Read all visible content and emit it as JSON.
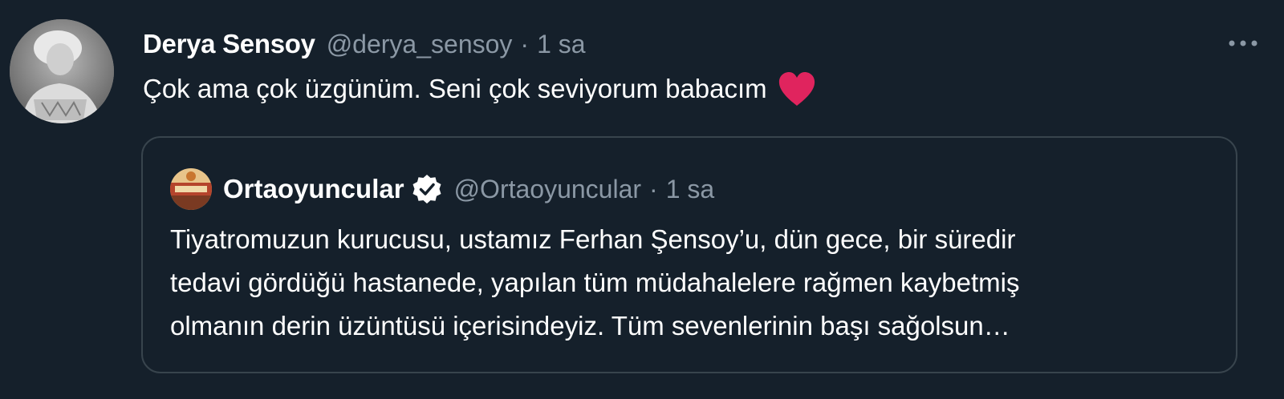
{
  "tweet": {
    "author_name": "Derya Sensoy",
    "handle": "@derya_sensoy",
    "separator": "·",
    "time": "1 sa",
    "text": "Çok ama çok üzgünüm. Seni çok seviyorum babacım",
    "emoji": "red-heart-emoji",
    "more_icon": "more-horizontal-icon"
  },
  "quoted_tweet": {
    "author_name": "Ortaoyuncular",
    "verified": true,
    "verified_icon": "verified-badge-icon",
    "handle": "@Ortaoyuncular",
    "separator": "·",
    "time": "1 sa",
    "text": "Tiyatromuzun kurucusu, ustamız Ferhan Şensoy’u, dün gece, bir süredir\ntedavi gördüğü hastanede, yapılan tüm müdahalelere rağmen kaybetmiş\nolmanın derin üzüntüsü içerisindeyiz. Tüm sevenlerinin başı sağolsun…"
  },
  "colors": {
    "background": "#15202b",
    "primary_text": "#ffffff",
    "secondary_text": "#8b98a5",
    "border": "#38444d",
    "heart": "#e0245e"
  }
}
